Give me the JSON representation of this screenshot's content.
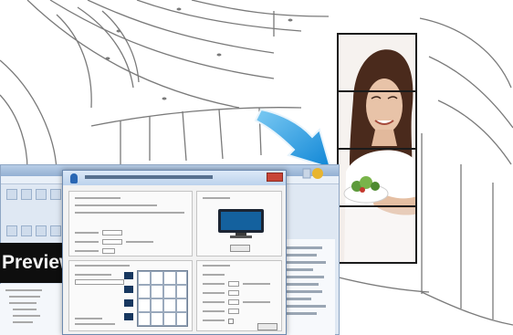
{
  "background": {
    "color": "#ffffff",
    "line_color": "#6f6f6f"
  },
  "video_wall": {
    "panel_count": 4,
    "frame_color": "#1b1b1b"
  },
  "arrow": {
    "color": "#1e9be3"
  },
  "software": {
    "preview_label": "Preview"
  }
}
